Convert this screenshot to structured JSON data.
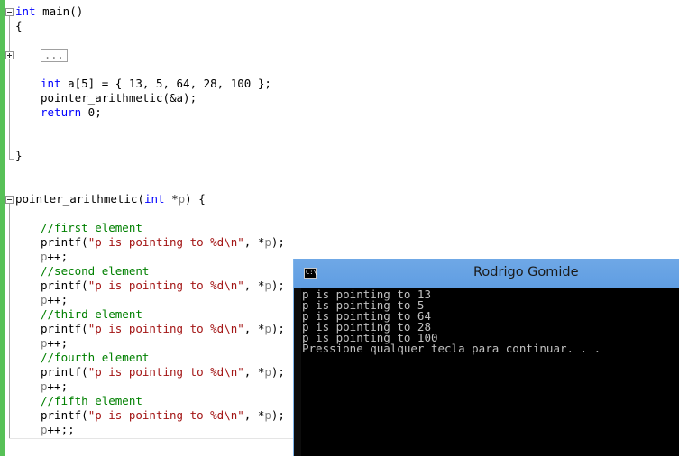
{
  "editor": {
    "main_signature": {
      "kw": "int",
      "rest": " main()"
    },
    "open_brace": "{",
    "collapsed_block": "...",
    "array_decl": {
      "kw": "int",
      "rest": " a[5] = { 13, 5, 64, 28, 100 };"
    },
    "call_line": "pointer_arithmetic(&a);",
    "return_line": {
      "kw": "return",
      "rest": " 0;"
    },
    "close_brace": "}",
    "func_signature": {
      "name": "pointer_arithmetic(",
      "kw": "int",
      "star": " *",
      "param": "p",
      "end": ") {"
    },
    "body": [
      {
        "comment": "//first element",
        "printf_fn": "printf(",
        "printf_str": "\"p is pointing to %d\\n\"",
        "printf_rest": ", *",
        "printf_param": "p",
        "printf_end": ");",
        "inc_param": "p",
        "inc_rest": "++;"
      },
      {
        "comment": "//second element",
        "printf_fn": "printf(",
        "printf_str": "\"p is pointing to %d\\n\"",
        "printf_rest": ", *",
        "printf_param": "p",
        "printf_end": ");",
        "inc_param": "p",
        "inc_rest": "++;"
      },
      {
        "comment": "//third element",
        "printf_fn": "printf(",
        "printf_str": "\"p is pointing to %d\\n\"",
        "printf_rest": ", *",
        "printf_param": "p",
        "printf_end": ");",
        "inc_param": "p",
        "inc_rest": "++;"
      },
      {
        "comment": "//fourth element",
        "printf_fn": "printf(",
        "printf_str": "\"p is pointing to %d\\n\"",
        "printf_rest": ", *",
        "printf_param": "p",
        "printf_end": ");",
        "inc_param": "p",
        "inc_rest": "++;"
      },
      {
        "comment": "//fifth element",
        "printf_fn": "printf(",
        "printf_str": "\"p is pointing to %d\\n\"",
        "printf_rest": ", *",
        "printf_param": "p",
        "printf_end": ");",
        "inc_param": "p",
        "inc_rest": "++;;"
      }
    ]
  },
  "console": {
    "icon_text": "C:\\",
    "title": "Rodrigo Gomide",
    "lines": [
      "p is pointing to 13",
      "p is pointing to 5",
      "p is pointing to 64",
      "p is pointing to 28",
      "p is pointing to 100",
      "Pressione qualquer tecla para continuar. . ."
    ]
  },
  "colors": {
    "keyword": "#0000ff",
    "string": "#a31515",
    "comment": "#008000",
    "parameter": "#808080",
    "change_bar": "#57c157",
    "console_titlebar": "#6fa8e6",
    "console_background": "#000000",
    "console_text": "#c0c0c0"
  }
}
